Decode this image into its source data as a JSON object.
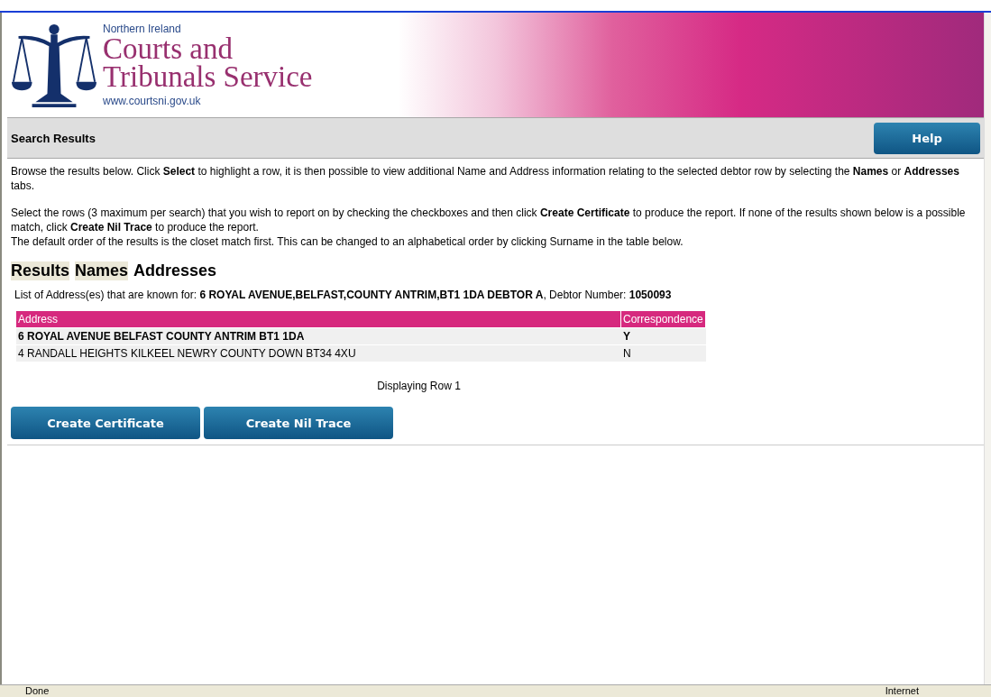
{
  "header": {
    "region": "Northern Ireland",
    "title_line_1": "Courts and",
    "title_line_2": "Tribunals Service",
    "url": "www.courtsni.gov.uk"
  },
  "title_bar": {
    "title": "Search Results",
    "help_button": "Help"
  },
  "instructions": [
    "Browse the results below. Click **Select** to highlight a row, it is then possible to view additional Name and Address information relating to the selected debtor row by selecting the **Names** or **Addresses** tabs.",
    "Select the rows (3 maximum per search) that you wish to report on by checking the checkboxes and then click **Create Certificate** to produce the report. If none of the results shown below is a possible match, click **Create Nil Trace** to produce the report.",
    "The default order of the results is the closet match first. This can be changed to an alphabetical order by clicking Surname in the table below."
  ],
  "tabs": [
    {
      "label": "Results",
      "selected": false
    },
    {
      "label": "Names",
      "selected": false
    },
    {
      "label": "Addresses",
      "selected": true
    }
  ],
  "known_for": "List of Address(es) that are known for: **6 ROYAL AVENUE,BELFAST,COUNTY ANTRIM,BT1 1DA DEBTOR A**, Debtor Number: **1050093**",
  "table": {
    "columns": [
      "Address",
      "Correspondence"
    ],
    "rows": [
      {
        "cells": [
          "6 ROYAL AVENUE BELFAST COUNTY ANTRIM BT1 1DA",
          "Y"
        ],
        "selected": true
      },
      {
        "cells": [
          "4 RANDALL HEIGHTS KILKEEL NEWRY COUNTY DOWN BT34 4XU",
          "N"
        ],
        "selected": false
      }
    ]
  },
  "paging": "Displaying Row 1",
  "buttons": [
    "Create Certificate",
    "Create Nil Trace"
  ],
  "status_bar": {
    "status": "Done",
    "zone": "Internet"
  }
}
